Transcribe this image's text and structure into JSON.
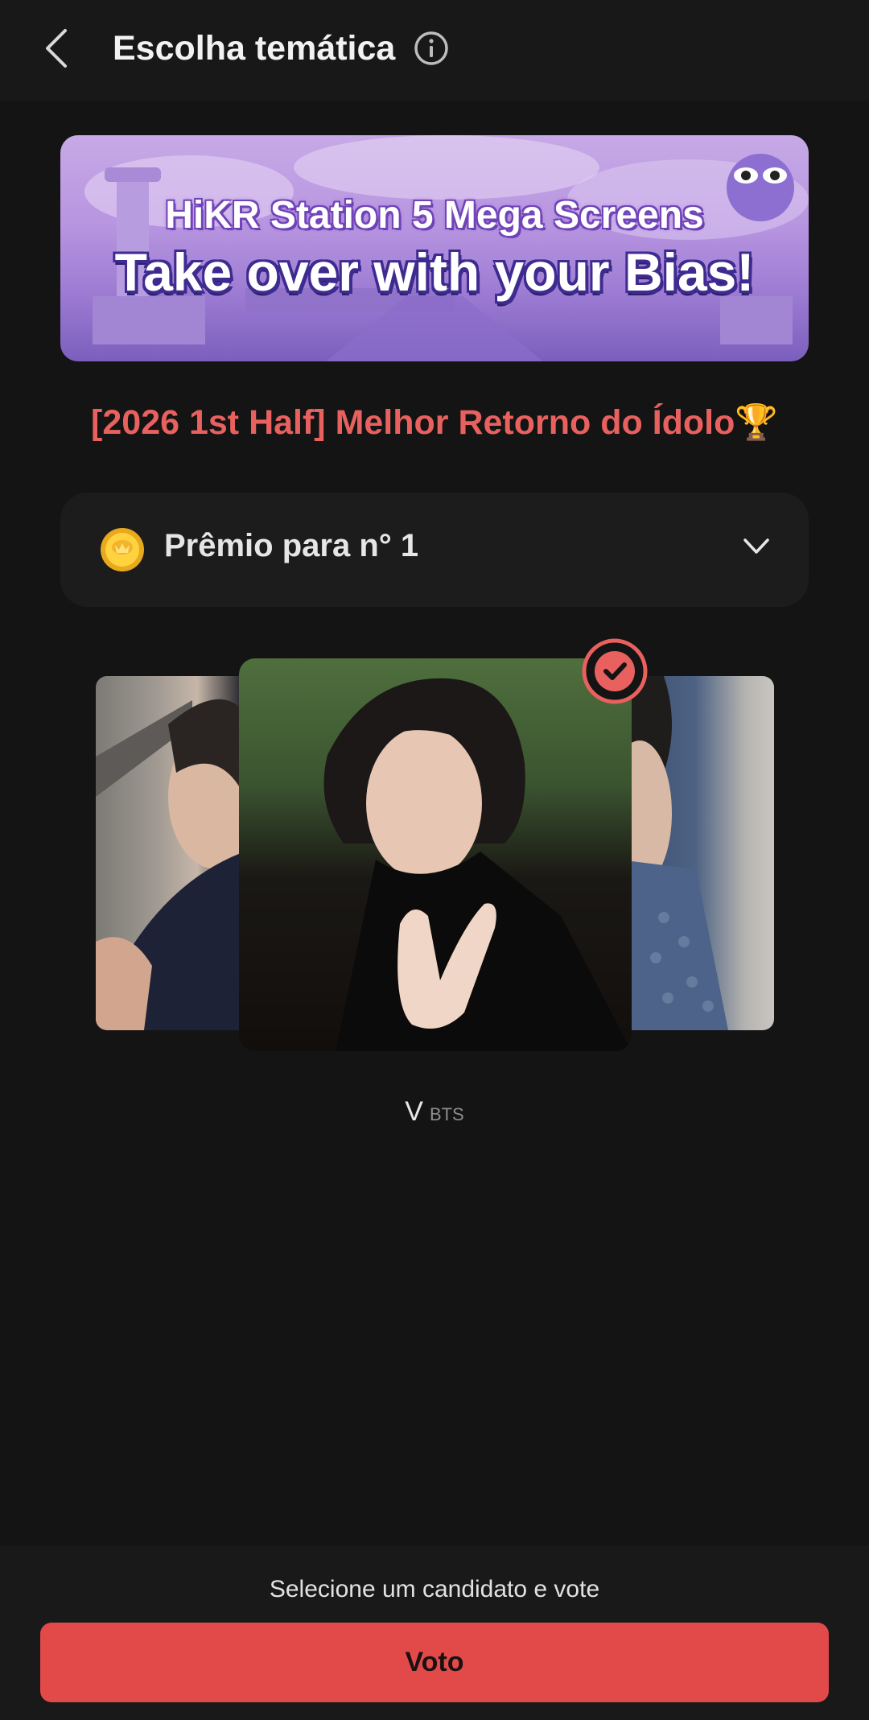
{
  "header": {
    "title": "Escolha temática"
  },
  "banner": {
    "line1": "HiKR Station 5 Mega Screens",
    "line2": "Take over with your Bias!"
  },
  "event": {
    "title": "[2026 1st Half] Melhor Retorno do Ídolo🏆"
  },
  "prize": {
    "label": "Prêmio para n° 1"
  },
  "candidate": {
    "name": "V",
    "group": "BTS"
  },
  "footer": {
    "message": "Selecione um candidato e vote",
    "vote_label": "Voto"
  },
  "colors": {
    "accent": "#e24a4a",
    "title": "#e8615f",
    "background": "#141414"
  },
  "icons": [
    "back-arrow-icon",
    "info-icon",
    "coin-icon",
    "chevron-down-icon",
    "check-circle-icon"
  ]
}
